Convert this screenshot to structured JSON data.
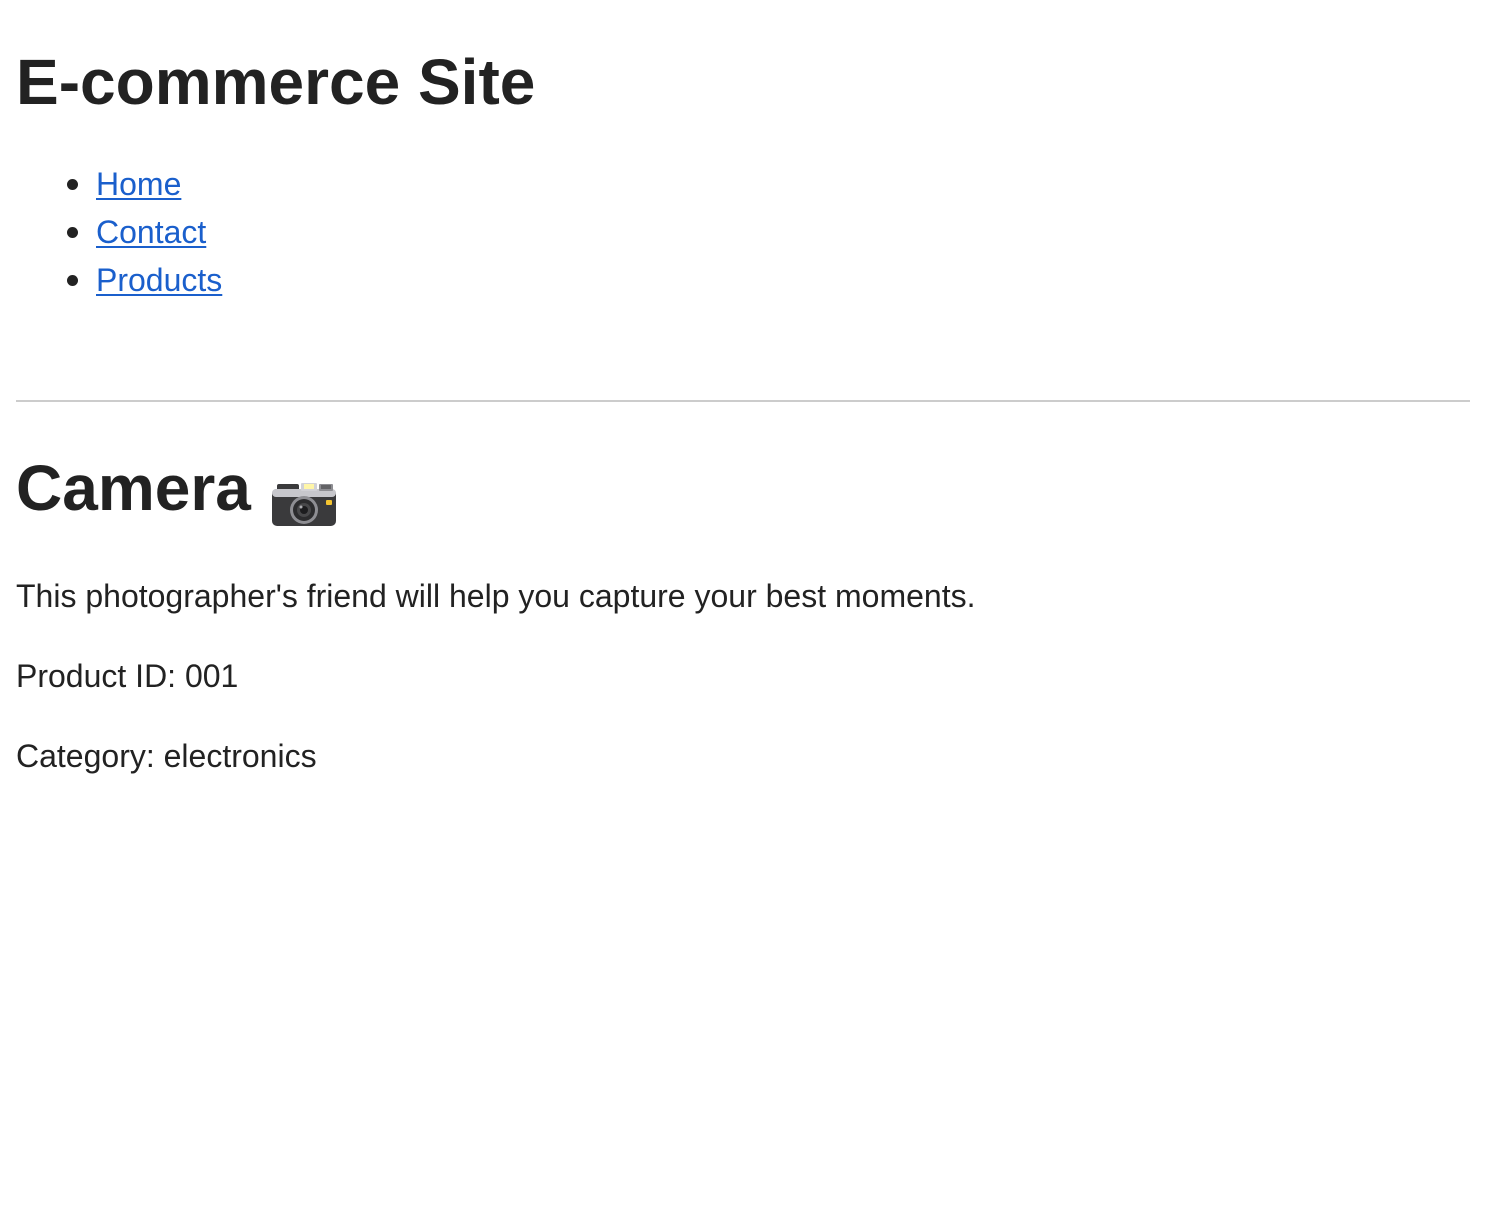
{
  "header": {
    "title": "E-commerce Site"
  },
  "nav": {
    "items": [
      {
        "label": "Home"
      },
      {
        "label": "Contact"
      },
      {
        "label": "Products"
      }
    ]
  },
  "product": {
    "name": "Camera",
    "icon": "camera-icon",
    "description": "This photographer's friend will help you capture your best moments.",
    "id_line": "Product ID: 001",
    "category_line": "Category: electronics"
  },
  "colors": {
    "text": "#222222",
    "link": "#1a5fcc",
    "divider": "#cccccc",
    "background": "#ffffff"
  }
}
